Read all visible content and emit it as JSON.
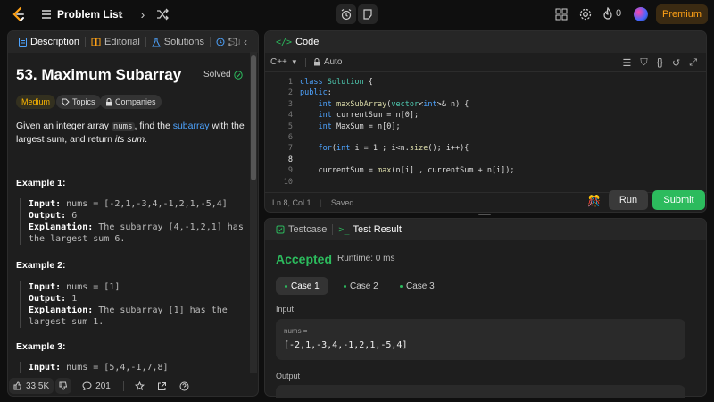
{
  "topbar": {
    "title": "Problem List",
    "fire_count": "0",
    "premium_label": "Premium"
  },
  "left_panel": {
    "tabs": [
      {
        "label": "Description"
      },
      {
        "label": "Editorial"
      },
      {
        "label": "Solutions"
      },
      {
        "label": "Su"
      }
    ]
  },
  "problem": {
    "title": "53. Maximum Subarray",
    "status": "Solved",
    "difficulty": "Medium",
    "topics_label": "Topics",
    "companies_label": "Companies",
    "desc_part1": "Given an integer array",
    "desc_code": "nums",
    "desc_part2": ", find the",
    "desc_link": "subarray",
    "desc_part3": "with the largest sum, and return",
    "desc_part4": "its sum",
    "desc_end": ".",
    "examples": [
      {
        "heading": "Example 1:",
        "input_label": "Input:",
        "input": "nums = [-2,1,-3,4,-1,2,1,-5,4]",
        "output_label": "Output:",
        "output": "6",
        "explanation_label": "Explanation:",
        "explanation_a": "The subarray [4,-1,2,1] has",
        "explanation_b": "the largest sum 6."
      },
      {
        "heading": "Example 2:",
        "input_label": "Input:",
        "input": "nums = [1]",
        "output_label": "Output:",
        "output": "1",
        "explanation_label": "Explanation:",
        "explanation_a": "The subarray [1] has the",
        "explanation_b": "largest sum 1."
      },
      {
        "heading": "Example 3:",
        "input_label": "Input:",
        "input": "nums = [5,4,-1,7,8]"
      }
    ],
    "likes": "33.5K",
    "comments": "201"
  },
  "editor": {
    "title": "Code",
    "language": "C++",
    "mode": "Auto",
    "status_pos": "Ln 8, Col 1",
    "status_saved": "Saved",
    "run_label": "Run",
    "submit_label": "Submit",
    "lines": [
      {
        "n": "1",
        "t": "class Solution {"
      },
      {
        "n": "2",
        "t": "public:"
      },
      {
        "n": "3",
        "t": "    int maxSubArray(vector<int>& n) {"
      },
      {
        "n": "4",
        "t": "    int currentSum = n[0];"
      },
      {
        "n": "5",
        "t": "    int MaxSum = n[0];"
      },
      {
        "n": "6",
        "t": ""
      },
      {
        "n": "7",
        "t": "    for(int i = 1 ; i<n.size(); i++){"
      },
      {
        "n": "8",
        "t": ""
      },
      {
        "n": "9",
        "t": "    currentSum = max(n[i] , currentSum + n[i]);"
      },
      {
        "n": "10",
        "t": ""
      }
    ]
  },
  "result_panel": {
    "tab_testcase": "Testcase",
    "tab_result": "Test Result",
    "verdict": "Accepted",
    "runtime": "Runtime: 0 ms",
    "cases": [
      "Case 1",
      "Case 2",
      "Case 3"
    ],
    "input_label": "Input",
    "var_name": "nums =",
    "var_value": "[-2,1,-3,4,-1,2,1,-5,4]",
    "output_label": "Output"
  },
  "colors": {
    "accent_green": "#2cbb5d",
    "premium": "#ffa116",
    "medium": "#ffb800",
    "link": "#4ea4ff"
  }
}
